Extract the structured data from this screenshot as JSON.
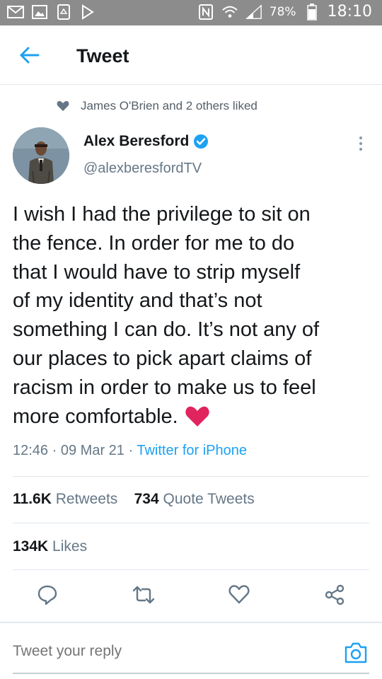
{
  "status_bar": {
    "battery": "78%",
    "time": "18:10",
    "icons": [
      "mail-icon",
      "image-icon",
      "recycle-icon",
      "play-store-icon",
      "nfc-icon",
      "wifi-icon",
      "signal-icon",
      "battery-icon"
    ]
  },
  "header": {
    "title": "Tweet"
  },
  "social_context": {
    "text": "James O'Brien and 2 others liked"
  },
  "author": {
    "name": "Alex Beresford",
    "handle": "@alexberesfordTV",
    "verified": true
  },
  "tweet": {
    "lines": [
      "I wish I had the privilege to sit on",
      "the fence. In order for me to do",
      "that I would have to strip myself",
      "of my identity and that’s not",
      "something I can do. It’s not any of",
      "our places to pick apart claims of",
      "racism in order to make us to feel",
      "more comfortable."
    ],
    "emoji": "heart",
    "time": "12:46",
    "date": "09 Mar 21",
    "separator": "·",
    "source": "Twitter for iPhone"
  },
  "stats": {
    "retweets_count": "11.6K",
    "retweets_label": "Retweets",
    "quotes_count": "734",
    "quotes_label": "Quote Tweets",
    "likes_count": "134K",
    "likes_label": "Likes"
  },
  "reply": {
    "placeholder": "Tweet your reply"
  },
  "colors": {
    "accent": "#1da1f2",
    "heart": "#e0245e",
    "statusbar": "#8c8c8c",
    "text": "#14171a",
    "muted": "#657786"
  }
}
